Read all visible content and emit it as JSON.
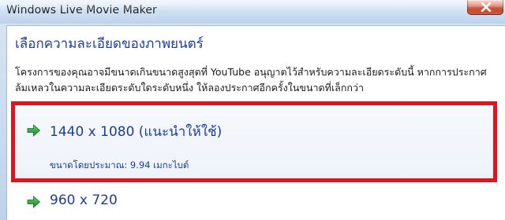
{
  "window": {
    "title": "Windows Live Movie Maker"
  },
  "dialog": {
    "heading": "เลือกความละเอียดของภาพยนตร์",
    "description_line1": "โครงการของคุณอาจมีขนาดเกินขนาดสูงสุดที่ YouTube อนุญาตไว้สำหรับความละเอียดระดับนี้ หากการประกาศ",
    "description_line2": "ล้มเหลวในความละเอียดระดับใดระดับหนึ่ง ให้ลองประกาศอีกครั้งในขนาดที่เล็กกว่า"
  },
  "options": [
    {
      "label": "1440 x 1080 (แนะนำให้ใช้)",
      "size_text": "ขนาดโดยประมาณ: 9.94 เมกะไบต์",
      "icon": "green-arrow-icon",
      "highlighted": true
    },
    {
      "label": "960 x 720",
      "icon": "green-arrow-icon",
      "highlighted": false
    }
  ],
  "colors": {
    "link_blue": "#1a3e9e",
    "highlight_red": "#e0141c",
    "arrow_green": "#1f9a2c",
    "close_red": "#c13a22"
  }
}
